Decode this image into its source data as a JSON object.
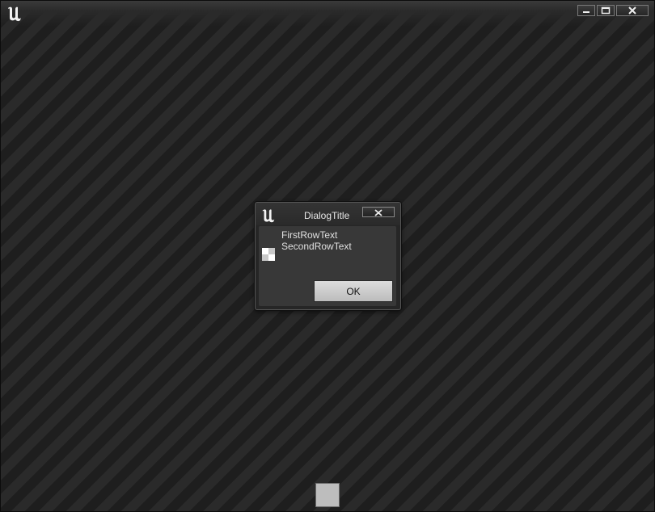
{
  "window": {
    "logo_icon": "unreal-engine-logo-icon",
    "controls": {
      "minimize_icon": "minimize-icon",
      "maximize_icon": "maximize-icon",
      "close_icon": "close-icon"
    }
  },
  "dialog": {
    "title": "DialogTitle",
    "logo_icon": "unreal-engine-logo-icon",
    "close_icon": "close-icon",
    "message_icon": "checker-placeholder-icon",
    "message_line1": "FirstRowText",
    "message_line2": "SecondRowText",
    "ok_label": "OK"
  },
  "colors": {
    "background_stripe_light": "#2a2a2a",
    "background_stripe_dark": "#1e1e1e",
    "dialog_body": "#383838",
    "button_face": "#cfcfcf"
  }
}
